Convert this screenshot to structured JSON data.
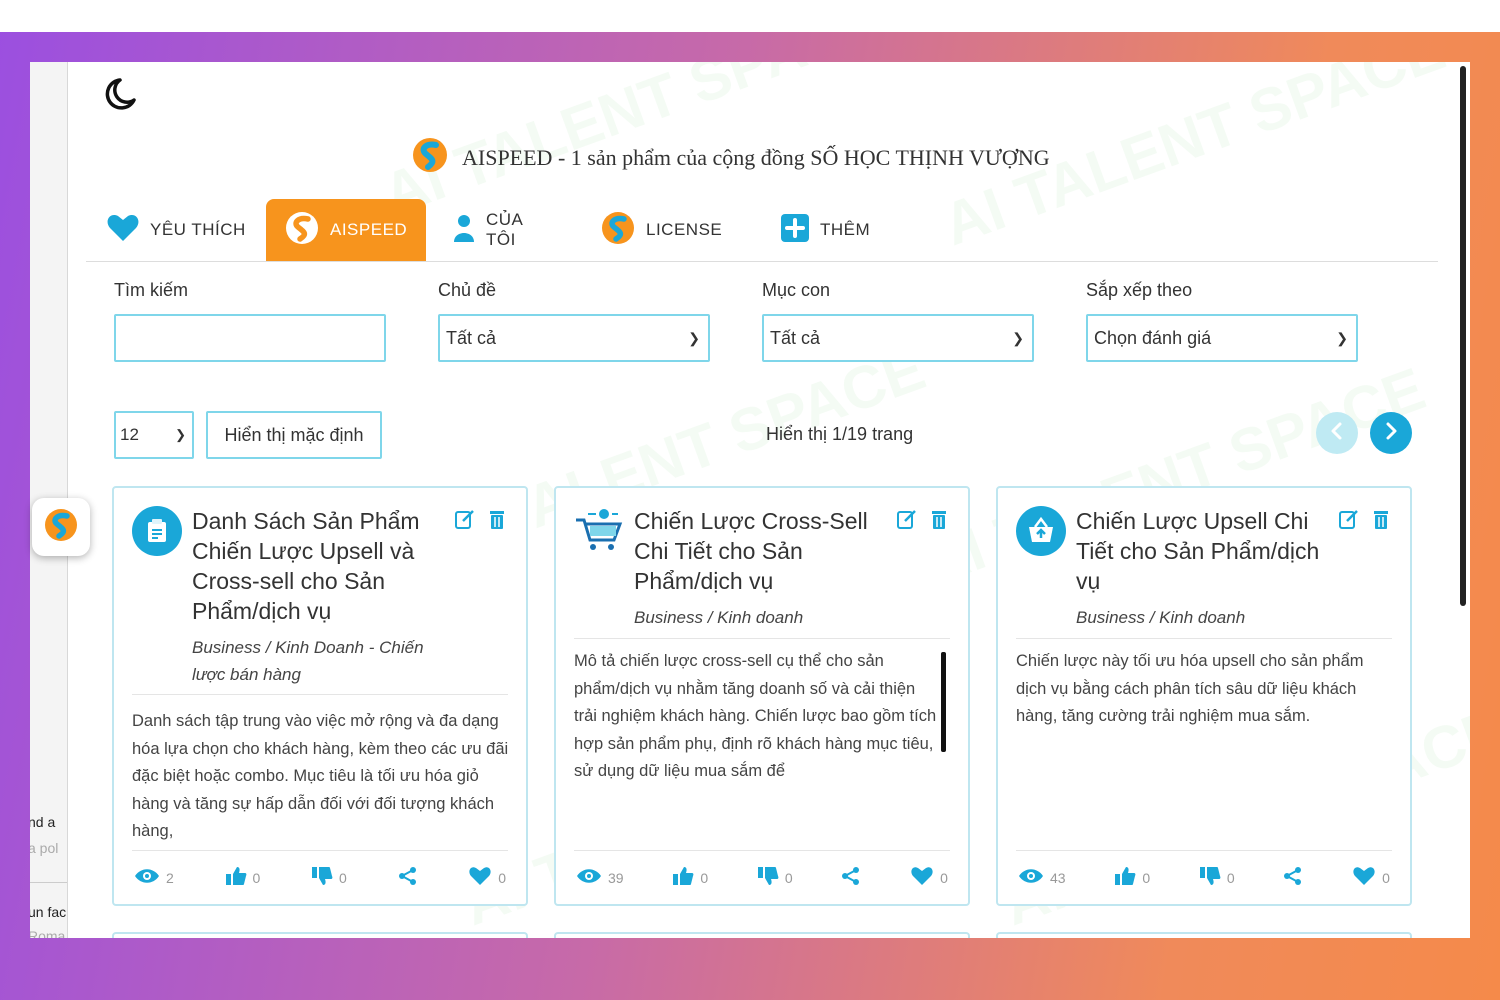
{
  "brand": {
    "title": "AISPEED - 1 sản phẩm của cộng đồng SỐ HỌC THỊNH VƯỢNG"
  },
  "tabs": [
    {
      "label": "YÊU THÍCH",
      "icon": "heart-icon"
    },
    {
      "label": "AISPEED",
      "icon": "aispeed-logo-icon",
      "active": true
    },
    {
      "label": "CỦA TÔI",
      "icon": "user-icon"
    },
    {
      "label": "LICENSE",
      "icon": "aispeed-logo-icon"
    },
    {
      "label": "THÊM",
      "icon": "plus-icon"
    }
  ],
  "filters": {
    "search_label": "Tìm kiếm",
    "search_value": "",
    "topic_label": "Chủ đề",
    "topic_value": "Tất cả",
    "subtopic_label": "Mục con",
    "subtopic_value": "Tất cả",
    "sort_label": "Sắp xếp theo",
    "sort_value": "Chọn đánh giá"
  },
  "pagination": {
    "per_page": "12",
    "display_default": "Hiển thị mặc định",
    "info": "Hiển thị 1/19 trang"
  },
  "left_panel": {
    "line1": "nd a",
    "line2": "a pol",
    "line3": "un fac",
    "line4": "Roma"
  },
  "watermark": "AI TALENT SPACE",
  "colors": {
    "accent_orange": "#f7941d",
    "accent_blue": "#1aa7d8",
    "border_blue": "#7fd6ea"
  },
  "cards": [
    {
      "title": "Danh Sách Sản Phẩm Chiến Lược Upsell và Cross-sell cho Sản Phẩm/dịch vụ",
      "category": "Business / Kinh Doanh - Chiến lược bán hàng",
      "description": "Danh sách tập trung vào việc mở rộng và đa dạng hóa lựa chọn cho khách hàng, kèm theo các ưu đãi đặc biệt hoặc combo. Mục tiêu là tối ưu hóa giỏ hàng và tăng sự hấp dẫn đối với đối tượng khách hàng,",
      "icon": "product-list-icon",
      "views": "2",
      "likes": "0",
      "dislikes": "0",
      "favorites": "0"
    },
    {
      "title": "Chiến Lược Cross-Sell Chi Tiết cho Sản Phẩm/dịch vụ",
      "category": "Business / Kinh doanh",
      "description": "Mô tả chiến lược cross-sell cụ thể cho sản phẩm/dịch vụ nhằm tăng doanh số và cải thiện trải nghiệm khách hàng. Chiến lược bao gồm tích hợp sản phẩm phụ, định rõ khách hàng mục tiêu, sử dụng dữ liệu mua sắm để",
      "icon": "shopping-cart-icon",
      "views": "39",
      "likes": "0",
      "dislikes": "0",
      "favorites": "0"
    },
    {
      "title": "Chiến Lược Upsell Chi Tiết cho Sản Phẩm/dịch vụ",
      "category": "Business / Kinh doanh",
      "description": "Chiến lược này tối ưu hóa upsell cho sản phẩm dịch vụ bằng cách phân tích sâu dữ liệu khách hàng, tăng cường trải nghiệm mua sắm.",
      "icon": "basket-icon",
      "views": "43",
      "likes": "0",
      "dislikes": "0",
      "favorites": "0"
    }
  ]
}
